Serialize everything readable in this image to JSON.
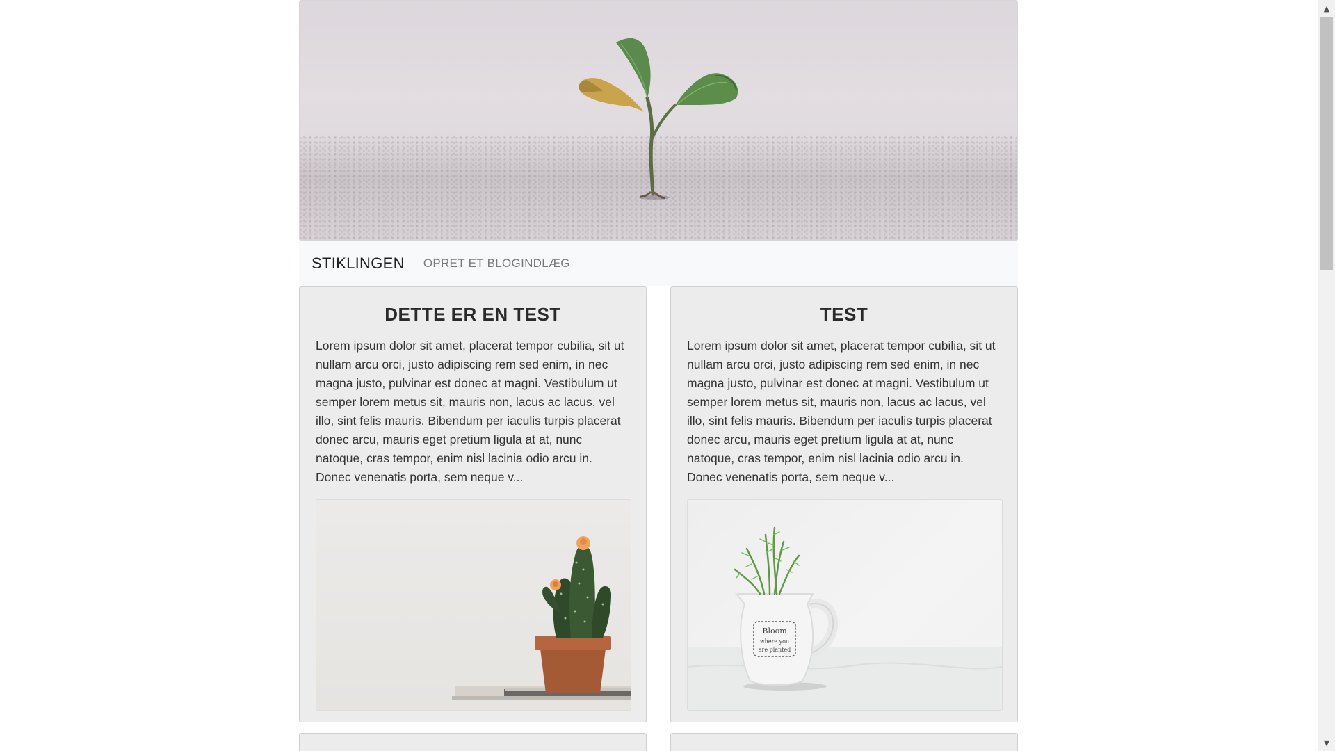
{
  "navbar": {
    "brand": "STIKLINGEN",
    "link": "OPRET ET BLOGINDLÆG"
  },
  "posts": [
    {
      "title": "DETTE ER EN TEST",
      "excerpt": "Lorem ipsum dolor sit amet, placerat tempor cubilia, sit ut nullam arcu orci, justo adipiscing rem sed enim, in nec magna justo, pulvinar est donec at magni. Vestibulum ut semper lorem metus sit, mauris non, lacus ac lacus, vel illo, sint felis mauris. Bibendum per iaculis turpis placerat donec arcu, mauris eget pretium ligula at at, nunc natoque, cras tempor, enim nisl lacinia odio arcu in. Donec venenatis porta, sem neque v...",
      "image": "cactus-pot-image"
    },
    {
      "title": "TEST",
      "excerpt": "Lorem ipsum dolor sit amet, placerat tempor cubilia, sit ut nullam arcu orci, justo adipiscing rem sed enim, in nec magna justo, pulvinar est donec at magni. Vestibulum ut semper lorem metus sit, mauris non, lacus ac lacus, vel illo, sint felis mauris. Bibendum per iaculis turpis placerat donec arcu, mauris eget pretium ligula at at, nunc natoque, cras tempor, enim nisl lacinia odio arcu in. Donec venenatis porta, sem neque v...",
      "image": "plant-in-pitcher-image"
    }
  ],
  "hero": {
    "image": "seedling-in-sand-image"
  },
  "mug_lettering": {
    "line1": "Bloom",
    "line2": "where you",
    "line3": "are planted"
  },
  "scrollbar": {
    "up_icon": "▲",
    "down_icon": "▼"
  },
  "colors": {
    "navbar_bg": "#f8f9fa",
    "card_bg": "#ececec",
    "brand_text": "#222222",
    "nav_link_text": "#7a7a7a"
  }
}
